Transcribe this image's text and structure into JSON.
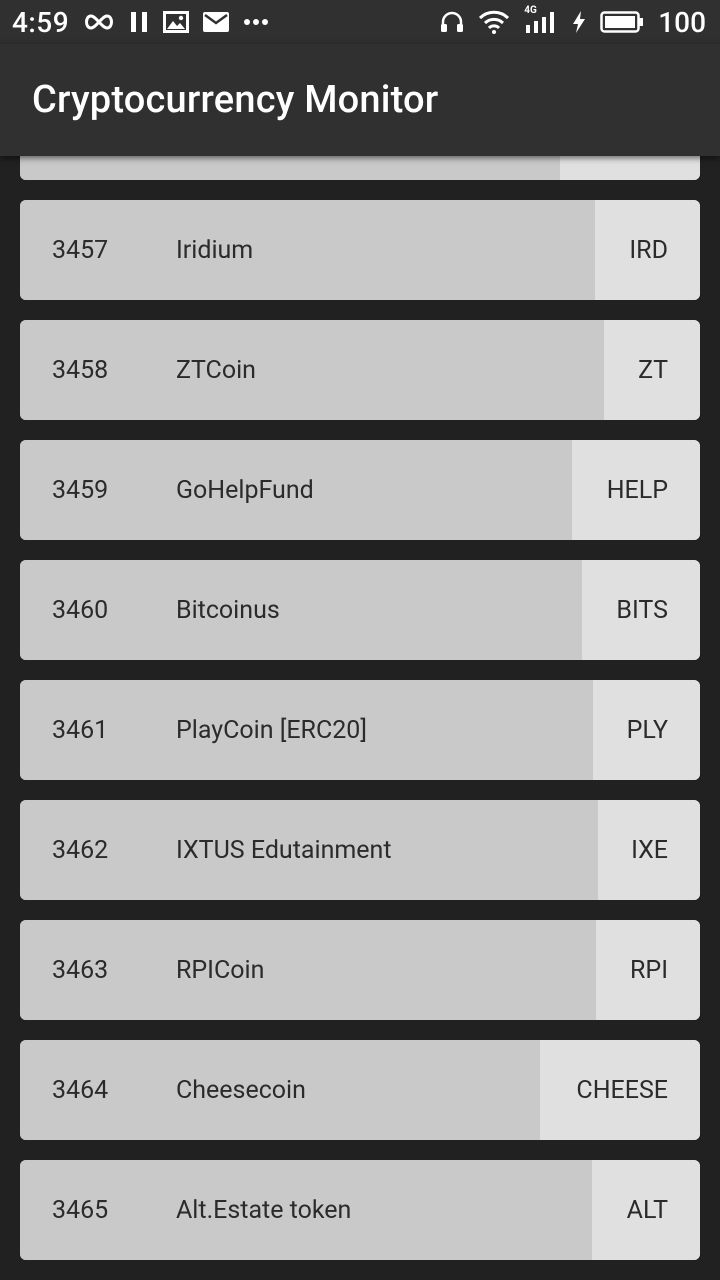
{
  "status_bar": {
    "time": "4:59",
    "battery": "100",
    "network": "4G",
    "left_icons": [
      "infinity-icon",
      "pause-icon",
      "image-icon",
      "mail-icon",
      "more-dots-icon"
    ],
    "right_icons": [
      "headphones-icon",
      "wifi-icon",
      "signal-icon",
      "charging-icon",
      "battery-icon"
    ]
  },
  "app_bar": {
    "title": "Cryptocurrency Monitor"
  },
  "coins": [
    {
      "rank": "",
      "name": "",
      "symbol": "",
      "main_fraction": 0.794
    },
    {
      "rank": "3457",
      "name": "Iridium",
      "symbol": "IRD",
      "main_fraction": 0.846
    },
    {
      "rank": "3458",
      "name": "ZTCoin",
      "symbol": "ZT",
      "main_fraction": 0.859
    },
    {
      "rank": "3459",
      "name": "GoHelpFund",
      "symbol": "HELP",
      "main_fraction": 0.812
    },
    {
      "rank": "3460",
      "name": "Bitcoinus",
      "symbol": "BITS",
      "main_fraction": 0.826
    },
    {
      "rank": "3461",
      "name": "PlayCoin [ERC20]",
      "symbol": "PLY",
      "main_fraction": 0.843
    },
    {
      "rank": "3462",
      "name": "IXTUS Edutainment",
      "symbol": "IXE",
      "main_fraction": 0.85
    },
    {
      "rank": "3463",
      "name": "RPICoin",
      "symbol": "RPI",
      "main_fraction": 0.847
    },
    {
      "rank": "3464",
      "name": "Cheesecoin",
      "symbol": "CHEESE",
      "main_fraction": 0.765
    },
    {
      "rank": "3465",
      "name": "Alt.Estate token",
      "symbol": "ALT",
      "main_fraction": 0.841
    }
  ],
  "colors": {
    "background": "#212121",
    "bar": "#303030",
    "row_main": "#c9c9c9",
    "row_symbol": "#e0e0e0",
    "text": "#2b2b2b"
  }
}
